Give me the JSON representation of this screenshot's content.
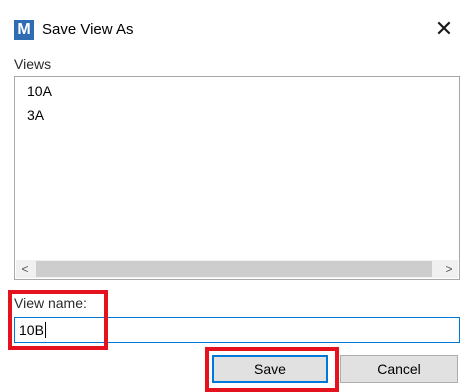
{
  "window": {
    "app_icon_letter": "M",
    "title": "Save View As",
    "close_glyph": "✕"
  },
  "views": {
    "label": "Views",
    "items": [
      "10A",
      "3A"
    ]
  },
  "scrollbar": {
    "left_arrow": "<",
    "right_arrow": ">"
  },
  "view_name": {
    "label": "View name:",
    "value": "10B"
  },
  "buttons": {
    "save_label": "Save",
    "cancel_label": "Cancel"
  },
  "colors": {
    "highlight": "#e3121c",
    "accent": "#0078d7",
    "app_icon": "#2e6db4"
  }
}
